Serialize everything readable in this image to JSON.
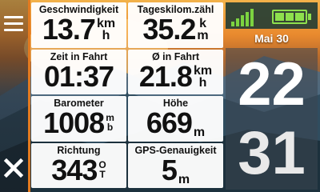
{
  "fields": [
    {
      "label": "Geschwindigkeit",
      "value": "13.7",
      "unit_top": "km",
      "unit_bottom": "h"
    },
    {
      "label": "Tageskilom.zähl",
      "value": "35.2",
      "unit_top": "k",
      "unit_bottom": "m"
    },
    {
      "label": "Zeit in Fahrt",
      "value": "01:37",
      "unit_top": "",
      "unit_bottom": ""
    },
    {
      "label": "Ø in Fahrt",
      "value": "21.8",
      "unit_top": "km",
      "unit_bottom": "h"
    },
    {
      "label": "Barometer",
      "value": "1008",
      "unit_top": "m",
      "unit_bottom": "b"
    },
    {
      "label": "Höhe",
      "value": "669",
      "unit_top": "",
      "unit_bottom": "m"
    },
    {
      "label": "Richtung",
      "value": "343",
      "unit_top": "O",
      "unit_bottom": "T"
    },
    {
      "label": "GPS-Genauigkeit",
      "value": "5",
      "unit_top": "",
      "unit_bottom": "m"
    }
  ],
  "status": {
    "signal_bars": 5,
    "battery_segments": 3,
    "color": "#8ee04d"
  },
  "date": "Mai 30",
  "clock": {
    "hour": "22",
    "minute": "31"
  },
  "accent": "#e37a1f",
  "icons": {
    "menu": "menu-icon",
    "close": "close-icon",
    "signal": "signal-icon",
    "battery": "battery-icon"
  }
}
